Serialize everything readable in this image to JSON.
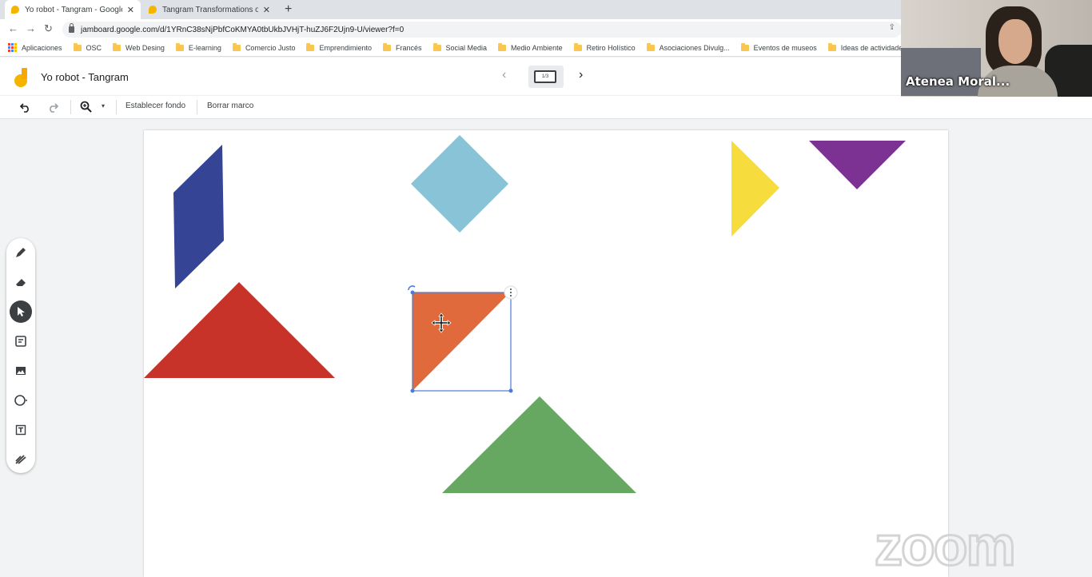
{
  "browser": {
    "tabs": [
      {
        "title": "Yo robot - Tangram - Google Jam",
        "active": true
      },
      {
        "title": "Tangram Transformations on Scr",
        "active": false
      }
    ],
    "url": "jamboard.google.com/d/1YRnC38sNjPbfCoKMYA0tbUkbJVHjT-huZJ6F2Ujn9-U/viewer?f=0",
    "bookmarks": [
      "Aplicaciones",
      "OSC",
      "Web Desing",
      "E-learning",
      "Comercio Justo",
      "Emprendimiento",
      "Francés",
      "Social Media",
      "Medio Ambiente",
      "Retiro Holístico",
      "Asociaciones Divulg...",
      "Eventos de museos",
      "Ideas de actividade..."
    ]
  },
  "jamboard": {
    "title": "Yo robot - Tangram",
    "frame_indicator": "1/3",
    "toolbar": {
      "set_background": "Establecer fondo",
      "clear_frame": "Borrar marco"
    },
    "tools": [
      "pen-icon",
      "eraser-icon",
      "select-icon",
      "sticky-note-icon",
      "image-icon",
      "circle-icon",
      "text-box-icon",
      "laser-icon"
    ],
    "shape_colors": {
      "parallelogram": "#354494",
      "square": "#88c3d8",
      "yellow_triangle": "#f6dc3c",
      "purple_triangle": "#7b3293",
      "red_triangle": "#c73329",
      "orange_triangle": "#e06a3b",
      "green_triangle": "#66a862"
    }
  },
  "video": {
    "participant_name": "Atenea Moral..."
  },
  "watermark": "zoom"
}
